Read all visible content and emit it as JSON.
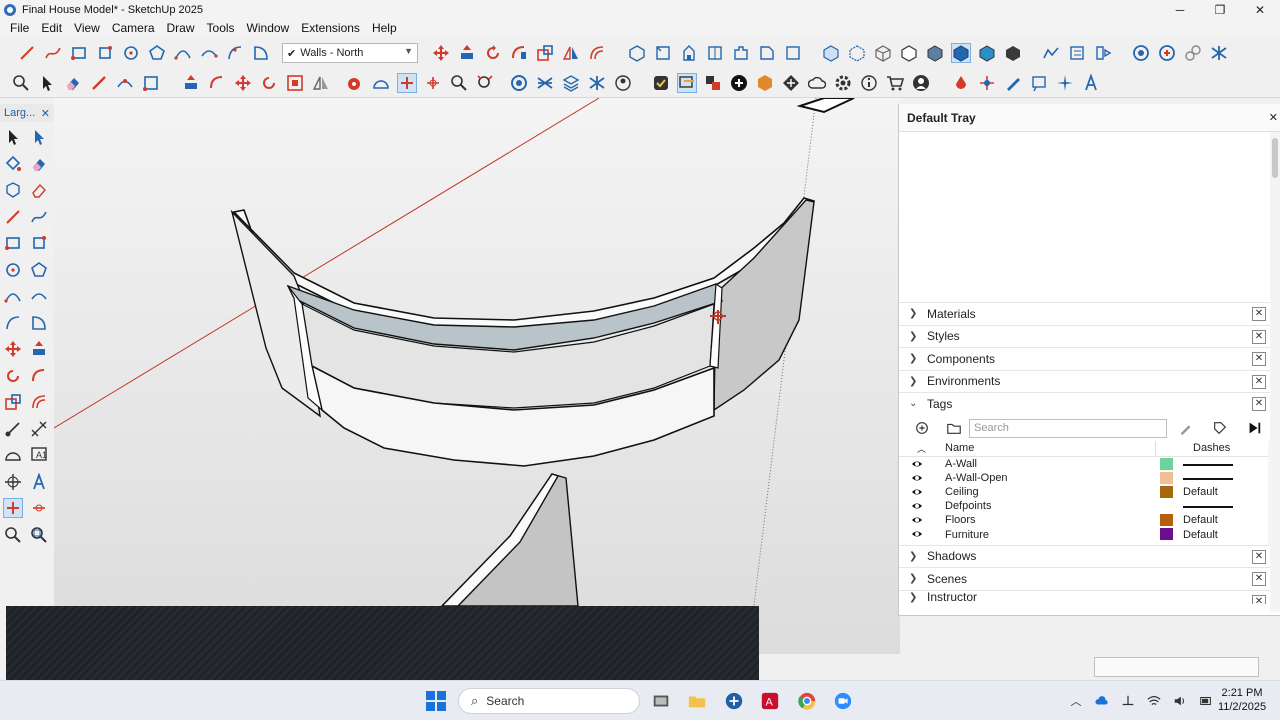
{
  "window": {
    "title": "Final House Model* - SketchUp 2025",
    "minimize": "─",
    "maximize": "❐",
    "close": "✕"
  },
  "menu": [
    "File",
    "Edit",
    "View",
    "Camera",
    "Draw",
    "Tools",
    "Window",
    "Extensions",
    "Help"
  ],
  "toolbar": {
    "active_tag": "Walls - North"
  },
  "left_toolbar": {
    "title": "Larg...",
    "close": "✕"
  },
  "tray": {
    "title": "Default Tray",
    "close": "✕",
    "panels_top": [
      {
        "label": "Materials",
        "expanded": false
      },
      {
        "label": "Styles",
        "expanded": false
      },
      {
        "label": "Components",
        "expanded": false
      },
      {
        "label": "Environments",
        "expanded": false
      },
      {
        "label": "Tags",
        "expanded": true
      }
    ],
    "tags": {
      "search_placeholder": "Search",
      "col_name": "Name",
      "col_dashes": "Dashes",
      "rows": [
        {
          "name": "A-Wall",
          "color": "#6ed39a",
          "dashes": "line"
        },
        {
          "name": "A-Wall-Open",
          "color": "#f2bf94",
          "dashes": "line"
        },
        {
          "name": "Ceiling",
          "color": "#a8660d",
          "dashes": "Default"
        },
        {
          "name": "Defpoints",
          "color": "#ffffff",
          "dashes": "line"
        },
        {
          "name": "Floors",
          "color": "#b6600e",
          "dashes": "Default"
        },
        {
          "name": "Furniture",
          "color": "#6a0f8e",
          "dashes": "Default"
        }
      ]
    },
    "panels_bottom": [
      {
        "label": "Shadows"
      },
      {
        "label": "Scenes"
      },
      {
        "label": "Instructor"
      }
    ]
  },
  "taskbar": {
    "search_label": "Search",
    "time": "2:21 PM",
    "date": "11/2/2025"
  },
  "colors": {
    "accent": "#1f5fa5",
    "red_axis": "#c0392b",
    "tool_red": "#d23a2a",
    "tool_blue": "#2466b0"
  }
}
